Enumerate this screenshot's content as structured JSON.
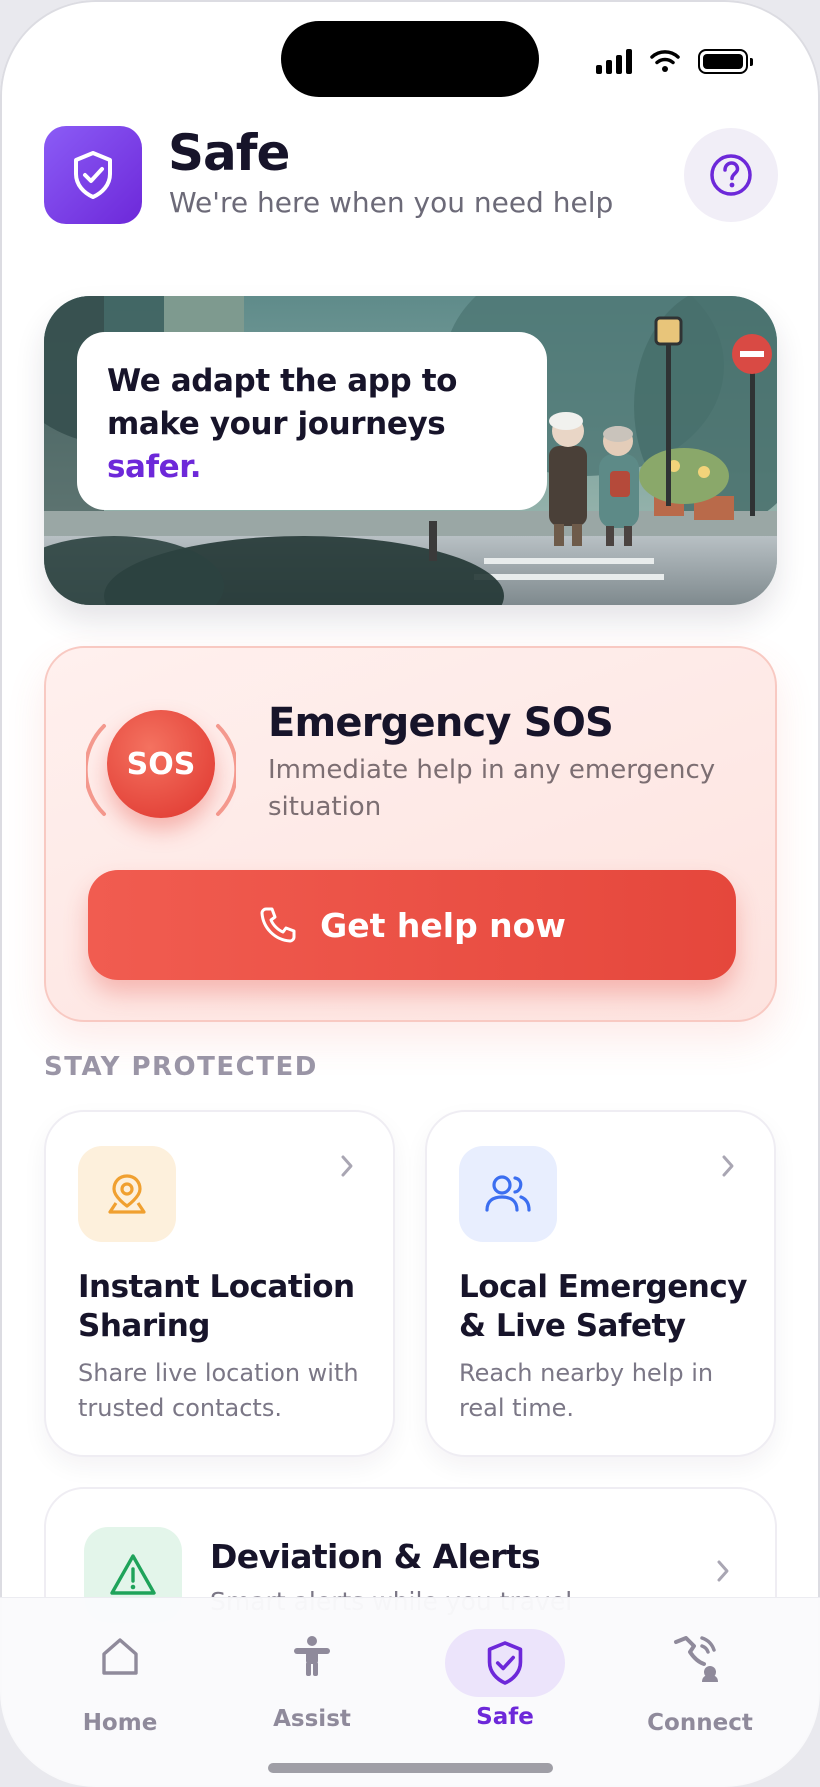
{
  "header": {
    "title": "Safe",
    "subtitle": "We're here when you need help"
  },
  "banner": {
    "line1": "We adapt the app to",
    "line2": "make your journeys",
    "highlight": "safer."
  },
  "sos": {
    "badge": "SOS",
    "title": "Emergency SOS",
    "description": "Immediate help in any emergency situation",
    "button_label": "Get help now"
  },
  "section": {
    "title": "STAY PROTECTED"
  },
  "features": [
    {
      "title": "Instant Location Sharing",
      "description": "Share live location with trusted contacts.",
      "icon": "map-pin-icon",
      "accent": "#f0a030",
      "tile_bg": "#fdf0dc"
    },
    {
      "title": "Local Emergency & Live Safety",
      "description": "Reach nearby help in real time.",
      "icon": "users-icon",
      "accent": "#3b6ef0",
      "tile_bg": "#e8eefe"
    }
  ],
  "deviation": {
    "title": "Deviation & Alerts",
    "description": "Smart alerts while you travel",
    "icon": "warning-triangle-icon",
    "accent": "#1fa35a"
  },
  "nav": {
    "items": [
      {
        "label": "Home",
        "icon": "home-icon"
      },
      {
        "label": "Assist",
        "icon": "person-icon"
      },
      {
        "label": "Safe",
        "icon": "shield-check-icon",
        "active": true
      },
      {
        "label": "Connect",
        "icon": "connect-icon"
      }
    ]
  },
  "colors": {
    "brand": "#6d28d9",
    "sos": "#e5473c",
    "text": "#17142a",
    "muted": "#7b7786"
  }
}
